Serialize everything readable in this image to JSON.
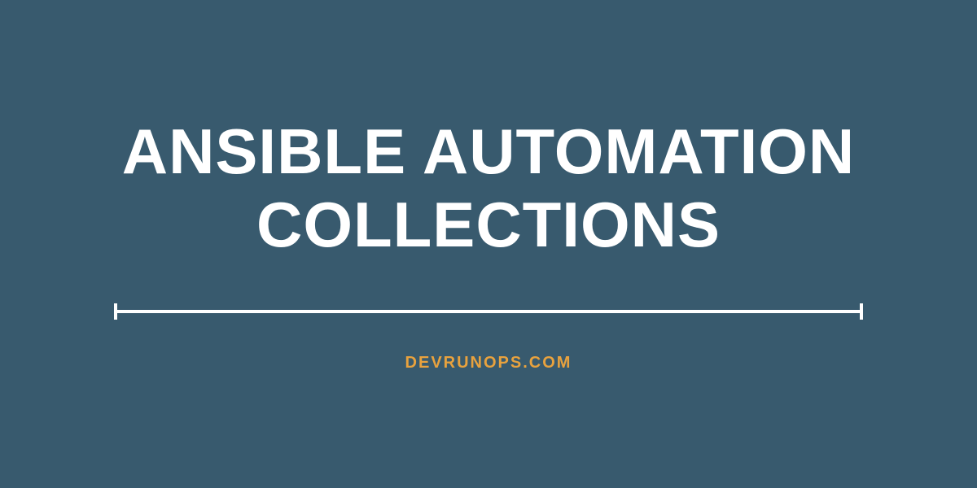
{
  "title": {
    "line1": "ANSIBLE AUTOMATION",
    "line2": "COLLECTIONS"
  },
  "footer": {
    "text": "DEVRUNOPS.COM"
  },
  "colors": {
    "background": "#385a6e",
    "title": "#ffffff",
    "divider": "#ffffff",
    "footer": "#e8a23e"
  }
}
